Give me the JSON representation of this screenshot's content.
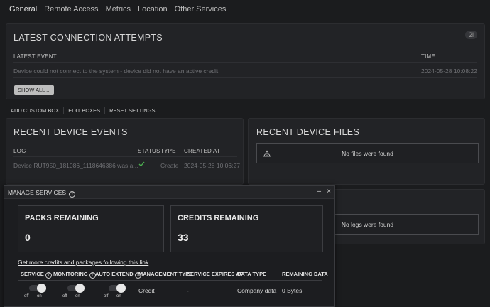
{
  "tabs": [
    "General",
    "Remote Access",
    "Metrics",
    "Location",
    "Other Services"
  ],
  "connection_attempts": {
    "title": "LATEST CONNECTION ATTEMPTS",
    "badge": "2i",
    "col_event": "LATEST EVENT",
    "col_time": "TIME",
    "event": "Device could not connect to the system - device did not have an active credit.",
    "time": "2024-05-28 10:08:22",
    "show_all": "SHOW ALL ..."
  },
  "links": [
    "ADD CUSTOM BOX",
    "EDIT BOXES",
    "RESET SETTINGS"
  ],
  "device_events": {
    "title": "RECENT DEVICE EVENTS",
    "cols": [
      "LOG",
      "STATUS",
      "TYPE",
      "CREATED AT"
    ],
    "row": {
      "log": "Device RUT950_181086_1118646386 was a...",
      "type": "Create",
      "created": "2024-05-28 10:06:27"
    }
  },
  "device_files": {
    "title": "RECENT DEVICE FILES",
    "empty": "No files were found"
  },
  "device_logs": {
    "empty": "No logs were found"
  },
  "modal": {
    "title": "MANAGE SERVICES",
    "minimize": "–",
    "close": "×",
    "packs_label": "PACKS REMAINING",
    "packs_value": "0",
    "credits_label": "CREDITS REMAINING",
    "credits_value": "33",
    "link": "Get more credits and packages following this link",
    "cols": {
      "service": "SERVICE",
      "monitoring": "MONITORING",
      "auto_extend": "AUTO EXTEND",
      "mgmt_type": "MANAGEMENT TYPE",
      "expires": "SERVICE EXPIRES AT",
      "data_type": "DATA TYPE",
      "remaining": "REMAINING DATA"
    },
    "row": {
      "mgmt_type": "Credit",
      "expires": "-",
      "data_type": "Company data",
      "remaining": "0 Bytes"
    },
    "toggle_off": "off",
    "toggle_on": "on"
  }
}
